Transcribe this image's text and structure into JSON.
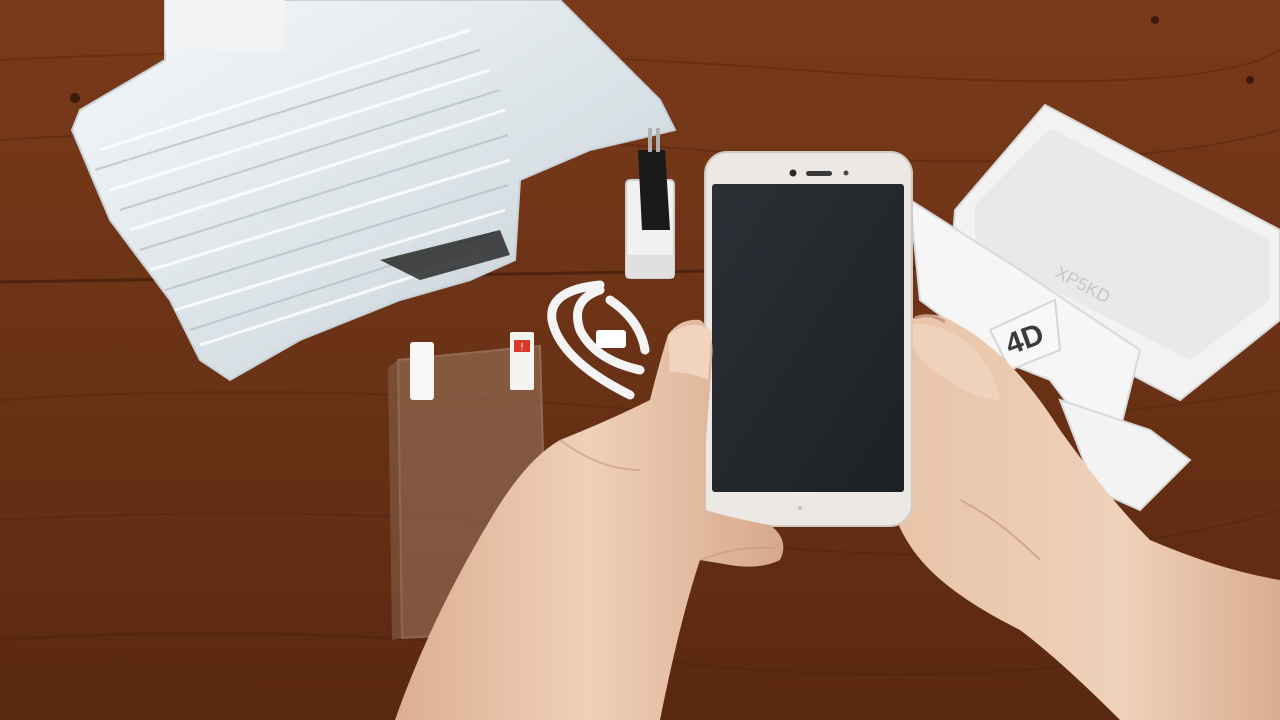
{
  "scene": {
    "colors": {
      "table": "#6e3418",
      "table_dark": "#4a200d",
      "table_light": "#8a4826",
      "bubble_wrap": "#e8eef2",
      "box_white": "#f4f4f4",
      "phone_body": "#ece8e2",
      "phone_screen": "#24272b",
      "skin": "#e9c3a8",
      "skin_shadow": "#c99a7e"
    },
    "objects": [
      "bubble-wrap-package",
      "wall-charger",
      "usb-cable",
      "screen-protector-film",
      "smartphone",
      "phone-box",
      "left-hand",
      "right-hand"
    ],
    "box_lid_text": "XP5KD",
    "box_inner_text": "4D",
    "protector_sticker_text": "!"
  }
}
